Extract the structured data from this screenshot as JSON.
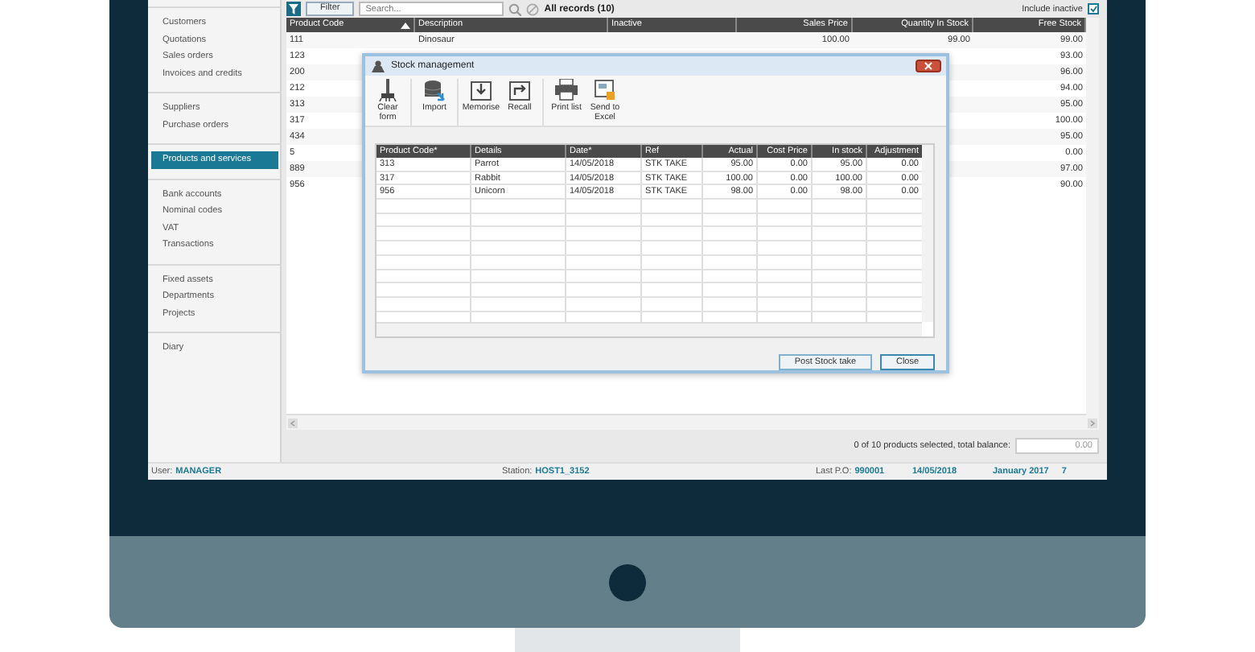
{
  "toolbar": {
    "filter_button": "Filter",
    "search": {
      "placeholder": "Search..."
    },
    "record_count": "All records (10)",
    "include_inactive": {
      "label": "Include inactive",
      "checked": true
    }
  },
  "sidebar": {
    "groups": [
      {
        "items": [
          {
            "label": "Customers",
            "selected": false
          },
          {
            "label": "Quotations",
            "selected": false
          },
          {
            "label": "Sales orders",
            "selected": false
          },
          {
            "label": "Invoices and credits",
            "selected": false
          }
        ]
      },
      {
        "items": [
          {
            "label": "Suppliers",
            "selected": false
          },
          {
            "label": "Purchase orders",
            "selected": false
          }
        ]
      },
      {
        "items": [
          {
            "label": "Products and services",
            "selected": true
          }
        ]
      },
      {
        "items": [
          {
            "label": "Bank accounts",
            "selected": false
          },
          {
            "label": "Nominal codes",
            "selected": false
          },
          {
            "label": "VAT",
            "selected": false
          },
          {
            "label": "Transactions",
            "selected": false
          }
        ]
      },
      {
        "items": [
          {
            "label": "Fixed assets",
            "selected": false
          },
          {
            "label": "Departments",
            "selected": false
          },
          {
            "label": "Projects",
            "selected": false
          }
        ]
      },
      {
        "items": [
          {
            "label": "Diary",
            "selected": false
          }
        ]
      }
    ]
  },
  "products": {
    "columns": [
      {
        "label": "Product Code",
        "numeric": false,
        "sorted": true
      },
      {
        "label": "Description",
        "numeric": false,
        "sorted": false
      },
      {
        "label": "Inactive",
        "numeric": false,
        "sorted": false
      },
      {
        "label": "Sales Price",
        "numeric": true,
        "sorted": false
      },
      {
        "label": "Quantity In Stock",
        "numeric": true,
        "sorted": false
      },
      {
        "label": "Free Stock",
        "numeric": true,
        "sorted": false
      }
    ],
    "rows": [
      {
        "cells": [
          "111",
          "Dinosaur",
          null,
          "100.00",
          "99.00",
          "99.00"
        ]
      },
      {
        "cells": [
          "123",
          null,
          null,
          null,
          null,
          "93.00"
        ]
      },
      {
        "cells": [
          "200",
          null,
          null,
          null,
          null,
          "96.00"
        ]
      },
      {
        "cells": [
          "212",
          null,
          null,
          null,
          null,
          "94.00"
        ]
      },
      {
        "cells": [
          "313",
          null,
          null,
          null,
          null,
          "95.00"
        ]
      },
      {
        "cells": [
          "317",
          null,
          null,
          null,
          null,
          "100.00"
        ]
      },
      {
        "cells": [
          "434",
          null,
          null,
          null,
          null,
          "95.00"
        ]
      },
      {
        "cells": [
          "5",
          null,
          null,
          null,
          null,
          "0.00"
        ]
      },
      {
        "cells": [
          "889",
          null,
          null,
          null,
          null,
          "97.00"
        ]
      },
      {
        "cells": [
          "956",
          null,
          null,
          null,
          null,
          "90.00"
        ]
      }
    ]
  },
  "summary": {
    "text": "0 of 10 products selected, total balance:",
    "balance": "0.00"
  },
  "status_bar": {
    "user_label": "User:",
    "user": "MANAGER",
    "station_label": "Station:",
    "station": "HOST1_3152",
    "last_po_label": "Last P.O:",
    "last_po": "990001",
    "date": "14/05/2018",
    "period": "January 2017",
    "period_number": "7"
  },
  "dialog": {
    "title": "Stock management",
    "tools": [
      {
        "kind": "clear",
        "label": "Clear form"
      },
      {
        "kind": "import",
        "label": "Import"
      },
      {
        "kind": "memorise",
        "label": "Memorise"
      },
      {
        "kind": "recall",
        "label": "Recall"
      },
      {
        "kind": "print",
        "label": "Print list"
      },
      {
        "kind": "excel",
        "label": "Send to Excel"
      }
    ],
    "columns": [
      {
        "label": "Product Code*",
        "numeric": false
      },
      {
        "label": "Details",
        "numeric": false
      },
      {
        "label": "Date*",
        "numeric": false
      },
      {
        "label": "Ref",
        "numeric": false
      },
      {
        "label": "Actual",
        "numeric": true
      },
      {
        "label": "Cost Price",
        "numeric": true
      },
      {
        "label": "In stock",
        "numeric": true
      },
      {
        "label": "Adjustment",
        "numeric": true
      }
    ],
    "rows": [
      {
        "cells": [
          "313",
          "Parrot",
          "14/05/2018",
          "STK TAKE",
          "95.00",
          "0.00",
          "95.00",
          "0.00"
        ]
      },
      {
        "cells": [
          "317",
          "Rabbit",
          "14/05/2018",
          "STK TAKE",
          "100.00",
          "0.00",
          "100.00",
          "0.00"
        ]
      },
      {
        "cells": [
          "956",
          "Unicorn",
          "14/05/2018",
          "STK TAKE",
          "98.00",
          "0.00",
          "98.00",
          "0.00"
        ]
      }
    ],
    "buttons": [
      "Post Stock take",
      "Close"
    ]
  }
}
